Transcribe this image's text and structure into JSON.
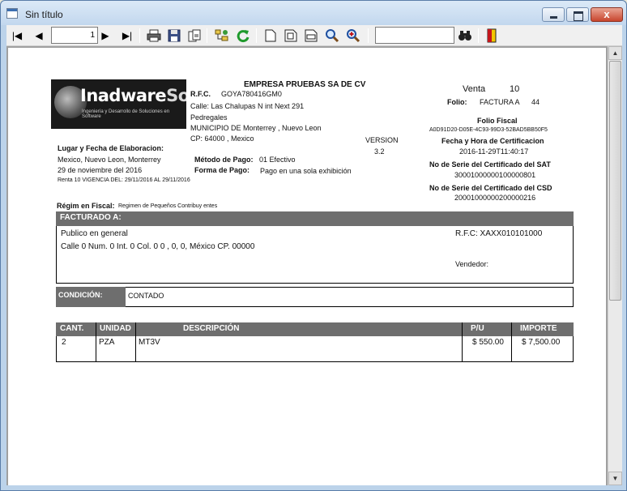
{
  "window": {
    "title": "Sin título",
    "close_glyph": "x"
  },
  "toolbar": {
    "first_icon": "first-page-icon",
    "prev_icon": "previous-page-icon",
    "page_value": "1",
    "next_icon": "next-page-icon",
    "last_icon": "last-page-icon",
    "print_icon": "printer-icon",
    "save_icon": "save-icon",
    "export_icon": "export-icon",
    "tree_icon": "group-tree-icon",
    "refresh_icon": "refresh-icon",
    "single_page_icon": "single-page-icon",
    "two_page_icon": "two-page-icon",
    "page_width_icon": "page-width-icon",
    "zoom_out_icon": "zoom-out-icon",
    "zoom_in_icon": "zoom-in-icon",
    "search_value": "",
    "find_icon": "binoculars-icon",
    "exit_icon": "exit-door-icon",
    "glyphs": {
      "first": "|◀",
      "prev": "◀",
      "next": "▶",
      "last": "▶|"
    }
  },
  "invoice": {
    "company": "EMPRESA PRUEBAS SA DE CV",
    "logo_name": "Inadware",
    "logo_name2": "Soft",
    "logo_tagline": "Ingeniería y Desarrollo de Soluciones en Software",
    "rfc_label": "R.F.C.",
    "rfc": "GOYA780416GM0",
    "street": "Calle: Las Chalupas  N int   Next 291",
    "neighborhood": "Pedregales",
    "municipality": "MUNICIPIO DE Monterrey , Nuevo Leon",
    "cp": "CP:   64000   , Mexico",
    "version_label": "VERSION",
    "version": "3.2",
    "place_label": "Lugar y Fecha de Elaboracion:",
    "place": "Mexico, Nuevo Leon, Monterrey",
    "date": "29 de noviembre del 2016",
    "validity": "Renta 10   VIGENCIA DEL:   29/11/2016   AL  29/11/2016",
    "payment_method_label": "Método de Pago:",
    "payment_method": "01 Efectivo",
    "payment_form_label": "Forma de Pago:",
    "payment_form": "Pago en una sola exhibición",
    "sale_label": "Venta",
    "sale_number": "10",
    "folio_label": "Folio:",
    "folio_type": "FACTURA  A",
    "folio_number": "44",
    "fiscal_folio_label": "Folio Fiscal",
    "fiscal_folio": "A0D91D20-D05E-4C93-99D3-52BAD5BB50F5",
    "cert_date_label": "Fecha y Hora de Certificacion",
    "cert_date": "2016-11-29T11:40:17",
    "sat_serial_label": "No de Serie del Certificado del SAT",
    "sat_serial": "30001000000100000801",
    "csd_serial_label": "No de Serie del Certificado del CSD",
    "csd_serial": "20001000000200000216",
    "regime_label": "Régim en Fiscal:",
    "regime": "Regimen de Pequeños Contribuy entes",
    "billed_to_label": "FACTURADO A:",
    "client_name": "Publico en general",
    "client_address": "Calle 0 Num. 0 Int. 0 Col. 0 0 , 0, 0, México CP. 00000",
    "client_rfc": "R.F.C:  XAXX010101000",
    "seller_label": "Vendedor:",
    "condition_label": "CONDICIÓN:",
    "condition": "CONTADO",
    "columns": [
      "CANT.",
      "UNIDAD",
      "DESCRIPCIÓN",
      "P/U",
      "IMPORTE"
    ],
    "rows": [
      {
        "qty": "2",
        "unit": "PZA",
        "desc": "MT3V",
        "price": "$ 550.00",
        "amount": "$ 7,500.00"
      }
    ]
  },
  "scrollbar": {
    "up_glyph": "▲",
    "down_glyph": "▼"
  }
}
